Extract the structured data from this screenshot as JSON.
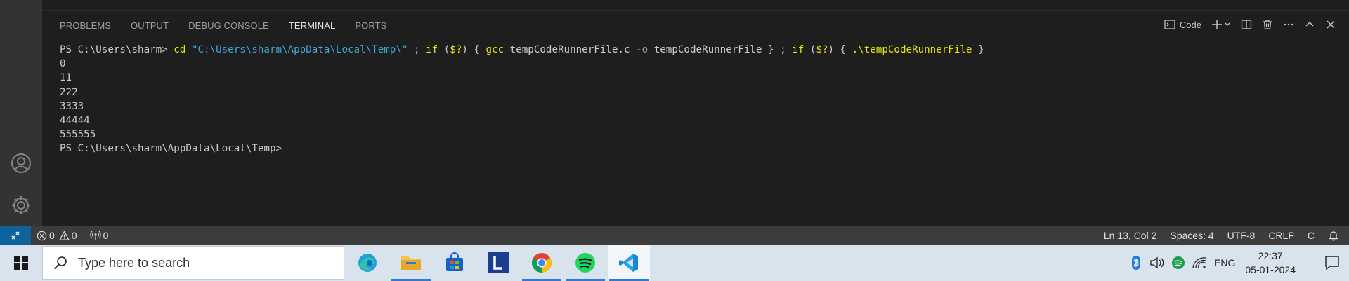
{
  "panel": {
    "tabs": [
      {
        "label": "PROBLEMS"
      },
      {
        "label": "OUTPUT"
      },
      {
        "label": "DEBUG CONSOLE"
      },
      {
        "label": "TERMINAL"
      },
      {
        "label": "PORTS"
      }
    ],
    "active_tab": "TERMINAL",
    "profile_label": "Code"
  },
  "terminal": {
    "prompt1": "PS C:\\Users\\sharm> ",
    "cmd": {
      "t1": "cd",
      "t2": " ",
      "t3": "\"C:\\Users\\sharm\\AppData\\Local\\Temp\\\"",
      "t4": " ; ",
      "t5": "if",
      "t6": " (",
      "t7": "$?",
      "t8": ") { ",
      "t9": "gcc",
      "t10": " tempCodeRunnerFile.c ",
      "t11": "-o",
      "t12": " tempCodeRunnerFile } ; ",
      "t13": "if",
      "t14": " (",
      "t15": "$?",
      "t16": ") { ",
      "t17": ".\\tempCodeRunnerFile",
      "t18": " }"
    },
    "output": [
      "0",
      "11",
      "222",
      "3333",
      "44444",
      "555555"
    ],
    "prompt2": "PS C:\\Users\\sharm\\AppData\\Local\\Temp>"
  },
  "statusbar": {
    "errors": "0",
    "warnings": "0",
    "ports": "0",
    "position": "Ln 13, Col 2",
    "spaces": "Spaces: 4",
    "encoding": "UTF-8",
    "eol": "CRLF",
    "language": "C"
  },
  "taskbar": {
    "search_placeholder": "Type here to search",
    "apps": [
      "edge-icon",
      "file-explorer-icon",
      "store-icon",
      "l-app-icon",
      "chrome-icon",
      "spotify-icon",
      "vscode-icon"
    ],
    "language": "ENG",
    "time": "22:37",
    "date": "05-01-2024"
  },
  "colors": {
    "activity_bar": "#333333",
    "panel_bg": "#1e1e1e",
    "status_bar": "#3c3c3c",
    "remote_accent": "#0e639c",
    "taskbar": "#d9e3ee",
    "terminal_yellow": "#e5e510",
    "terminal_cyan": "#3fa5d6"
  }
}
